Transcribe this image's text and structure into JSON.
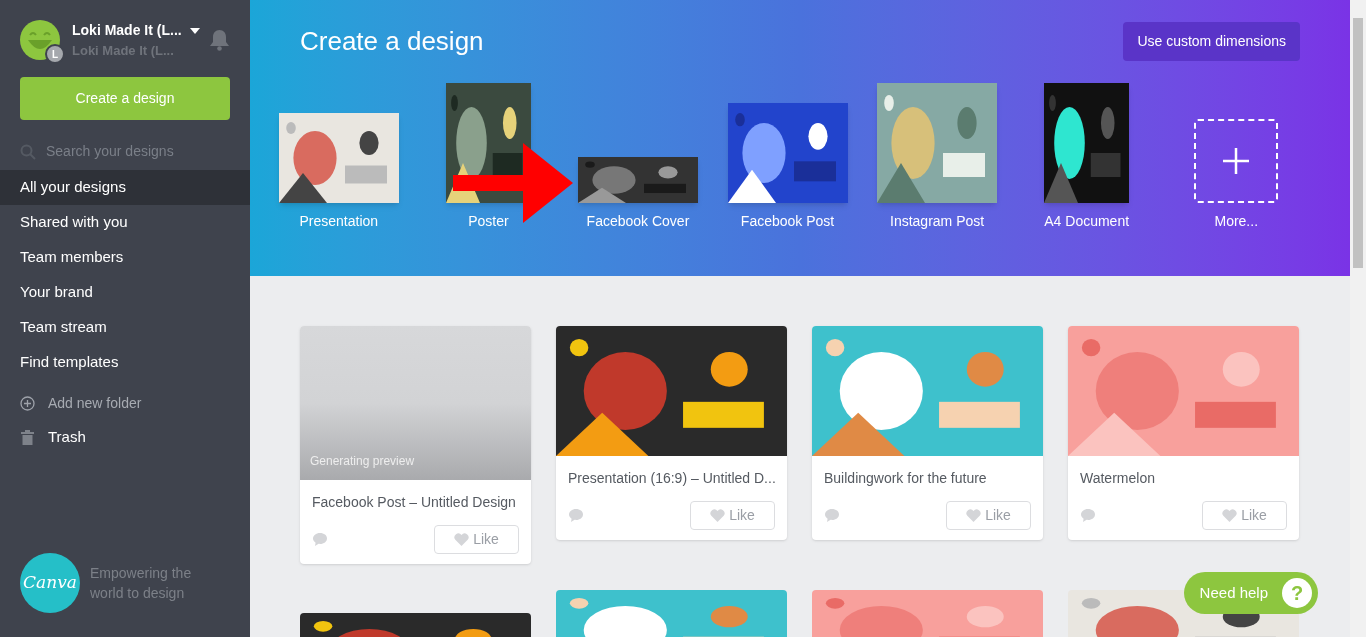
{
  "user": {
    "name": "Loki Made It (L...",
    "subtitle": "Loki Made It (L...",
    "initial": "L"
  },
  "create_button": "Create a design",
  "search": {
    "placeholder": "Search your designs"
  },
  "nav": [
    {
      "label": "All your designs",
      "selected": true
    },
    {
      "label": "Shared with you",
      "selected": false
    },
    {
      "label": "Team members",
      "selected": false
    },
    {
      "label": "Your brand",
      "selected": false
    },
    {
      "label": "Team stream",
      "selected": false
    },
    {
      "label": "Find templates",
      "selected": false
    }
  ],
  "folder_actions": [
    {
      "kind": "add",
      "label": "Add new folder"
    },
    {
      "kind": "trash",
      "label": "Trash"
    }
  ],
  "brand": {
    "logo": "Canva",
    "tagline": "Empowering the world to design"
  },
  "header": {
    "title": "Create a design",
    "custom_button": "Use custom dimensions",
    "templates": [
      {
        "label": "Presentation",
        "kind": "wide"
      },
      {
        "label": "Poster",
        "kind": "tall"
      },
      {
        "label": "Facebook Cover",
        "kind": "banner"
      },
      {
        "label": "Facebook Post",
        "kind": "post"
      },
      {
        "label": "Instagram Post",
        "kind": "square"
      },
      {
        "label": "A4 Document",
        "kind": "tall"
      },
      {
        "label": "More...",
        "kind": "more"
      }
    ]
  },
  "designs": [
    {
      "title": "Facebook Post – Untitled Design",
      "status": "Generating preview",
      "like": "Like"
    },
    {
      "title": "Presentation (16:9) – Untitled D...",
      "like": "Like"
    },
    {
      "title": "Buildingwork for the future",
      "like": "Like"
    },
    {
      "title": "Watermelon",
      "like": "Like"
    }
  ],
  "help_button": {
    "label": "Need help",
    "icon": "?"
  }
}
